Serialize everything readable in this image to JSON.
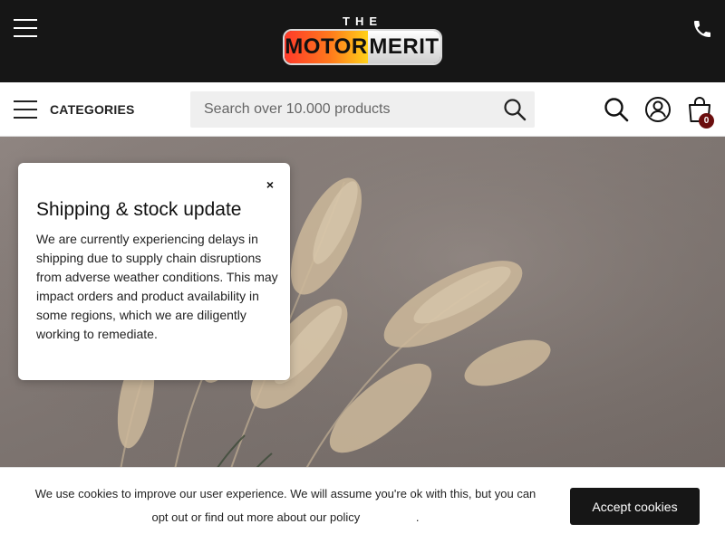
{
  "header": {
    "menu_icon": "hamburger-menu-icon",
    "phone_icon": "phone-icon",
    "logo": {
      "top": "THE",
      "left": "MOTOR",
      "right": "MERIT"
    }
  },
  "nav": {
    "categories_label": "CATEGORIES",
    "search_placeholder": "Search over 10.000 products",
    "icons": [
      "search-icon",
      "user-account-icon",
      "shopping-bag-icon"
    ],
    "cart_count": "0"
  },
  "popup": {
    "close_symbol": "×",
    "title": "Shipping & stock update",
    "body": "We are currently experiencing delays in shipping due to supply chain disruptions from adverse weather conditions. This may impact orders and product availability in some regions, which we are diligently working to remediate."
  },
  "cookie_banner": {
    "text_before_link": "We use cookies to improve our user experience. We will assume you're ok with this, but you can opt out or find out more about our policy",
    "text_after_link": ".",
    "accept_label": "Accept cookies"
  },
  "colors": {
    "topbar": "#161616",
    "cart_badge": "#6b0e0e",
    "hero_background": "#7d7470",
    "button": "#161616"
  }
}
